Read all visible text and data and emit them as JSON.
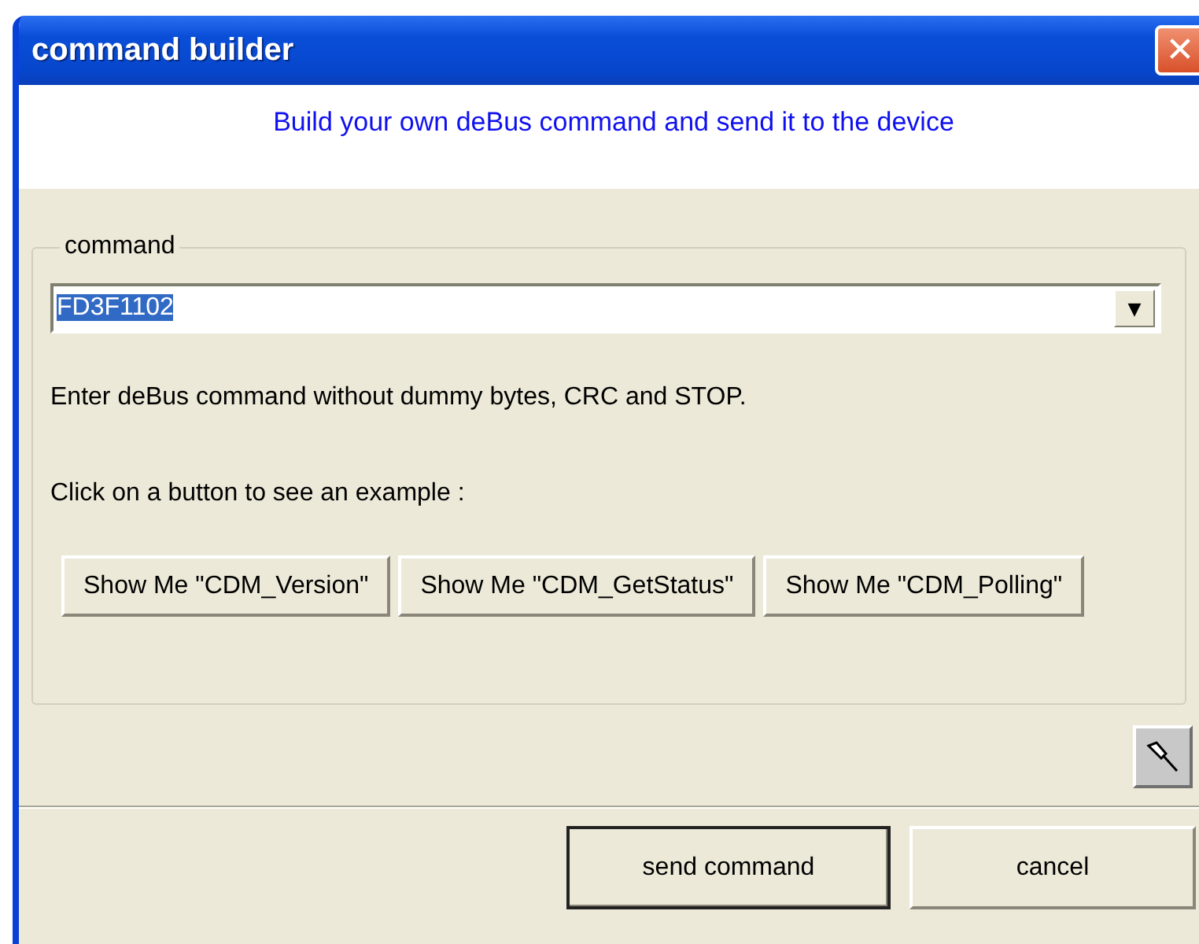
{
  "window": {
    "title": "command builder",
    "close_button": "✕"
  },
  "header": {
    "text": "Build your own deBus command and send it to the device"
  },
  "command_group": {
    "label": "command",
    "combo": {
      "value": "FD3F1102",
      "value_selected": true,
      "arrow": "▼"
    },
    "hint": "Enter deBus command without dummy bytes, CRC and STOP.",
    "instruction": "Click on a button to see an example :",
    "example_buttons": [
      {
        "label": "Show Me \"CDM_Version\""
      },
      {
        "label": "Show Me \"CDM_GetStatus\""
      },
      {
        "label": "Show Me \"CDM_Polling\""
      }
    ]
  },
  "buttons": [
    {
      "label": "send command",
      "default": true
    },
    {
      "label": "cancel",
      "default": false
    }
  ]
}
